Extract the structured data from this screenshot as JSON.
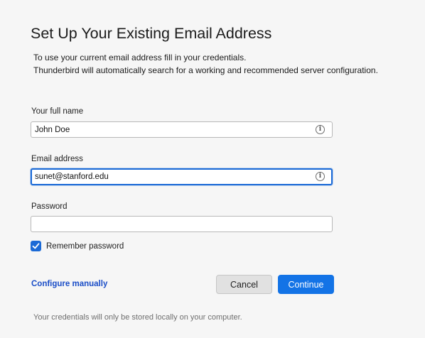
{
  "header": {
    "title": "Set Up Your Existing Email Address",
    "description_line1": "To use your current email address fill in your credentials.",
    "description_line2": "Thunderbird will automatically search for a working and recommended server configuration."
  },
  "form": {
    "full_name": {
      "label": "Your full name",
      "value": "John Doe",
      "icon": "info-icon"
    },
    "email": {
      "label": "Email address",
      "value": "sunet@stanford.edu",
      "icon": "info-icon",
      "focused": true
    },
    "password": {
      "label": "Password",
      "value": ""
    },
    "remember_password": {
      "label": "Remember password",
      "checked": true
    }
  },
  "actions": {
    "configure_manually": "Configure manually",
    "cancel": "Cancel",
    "continue": "Continue"
  },
  "footer": {
    "note": "Your credentials will only be stored locally on your computer."
  },
  "colors": {
    "accent": "#1373e6",
    "focus_ring": "#1b6ad6",
    "link": "#1a4dc7",
    "background": "#f6f6f6"
  }
}
